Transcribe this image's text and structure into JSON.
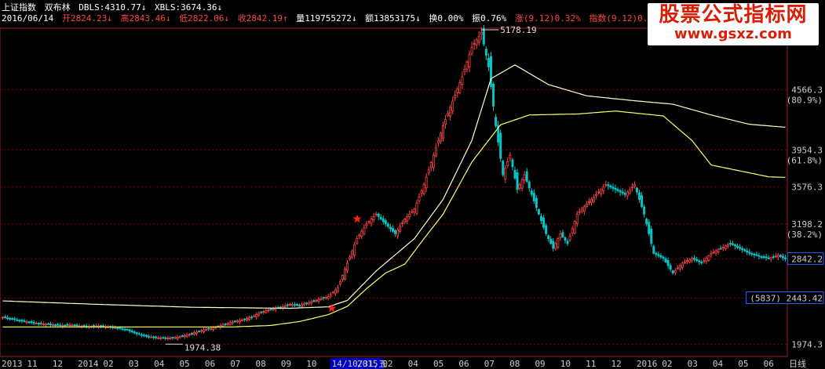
{
  "header": {
    "index_name": "上证指数",
    "indicator_name": "双布林",
    "dbls": "DBLS:4310.77↓",
    "xbls": "XBLS:3674.36↓",
    "date": "2016/06/14",
    "open": "开2824.23↓",
    "high": "高2843.46↓",
    "low": "低2822.06↓",
    "close": "收2842.19↑",
    "volume": "量119755272↓",
    "amount": "额13853175↓",
    "turnover": "换0.00%",
    "amplitude": "振0.76%",
    "change": "涨(9.12)0.32%",
    "index_change": "指数(9.12)0.32%"
  },
  "watermark": {
    "title": "股票公式指标网",
    "url": "www.gsxz.com"
  },
  "colors": {
    "up": "#ff4444",
    "down": "#00c8c8",
    "ma_long": "#ffffcc",
    "ma_mid": "#ffff66",
    "grid": "#8b0000",
    "axis": "#a02020",
    "label": "#cccccc",
    "star": "#ff2020",
    "header_red": "#ff4444",
    "header_cyan": "#00d0d0",
    "date_hl_bg": "#0000c0"
  },
  "chart_data": {
    "type": "candlestick",
    "symbol": "上证指数",
    "ylim": [
      1849,
      5178.19
    ],
    "y_ticks": [
      {
        "value": 4566.3,
        "label": "4566.3",
        "sub": "(80.9%)"
      },
      {
        "value": 3954.3,
        "label": "3954.3",
        "sub": "(61.8%)"
      },
      {
        "value": 3576.3,
        "label": "3576.3",
        "sub": ""
      },
      {
        "value": 3198.2,
        "label": "3198.2",
        "sub": "(38.2%)"
      },
      {
        "value": 2842.2,
        "label": "2842.2",
        "sub": "",
        "boxed": true
      },
      {
        "value": 2443.42,
        "label": "2443.42",
        "sub": "",
        "boxed": true,
        "pre": "(5837)"
      },
      {
        "value": 1974.3,
        "label": "1974.3",
        "sub": ""
      }
    ],
    "x_labels": [
      "2013",
      "11",
      "12",
      "2014",
      "02",
      "03",
      "04",
      "05",
      "06",
      "07",
      "08",
      "09",
      "10",
      "14/10/31,五",
      "2015",
      "02",
      "04",
      "05",
      "06",
      "07",
      "08",
      "09",
      "10",
      "11",
      "12",
      "2016",
      "02",
      "03",
      "04",
      "05",
      "06",
      "日线"
    ],
    "highlighted_x_label": "14/10/31,五",
    "annotations": [
      {
        "text": "5178.19",
        "type": "max",
        "value": 5178.19
      },
      {
        "text": "1974.38",
        "type": "min",
        "value": 1974.38
      }
    ],
    "stars": [
      {
        "near_label": "14/10/31,五",
        "value": 2340
      },
      {
        "near_label": "2015",
        "value": 3250
      }
    ],
    "series": [
      {
        "points": [
          [
            0,
            2250
          ],
          [
            4,
            2230
          ],
          [
            8,
            2210
          ],
          [
            12,
            2195
          ],
          [
            16,
            2180
          ],
          [
            20,
            2175
          ],
          [
            24,
            2165
          ],
          [
            28,
            2170
          ],
          [
            32,
            2160
          ],
          [
            36,
            2155
          ],
          [
            40,
            2160
          ],
          [
            44,
            2150
          ],
          [
            48,
            2140
          ],
          [
            52,
            2120
          ],
          [
            56,
            2080
          ],
          [
            60,
            2055
          ],
          [
            64,
            2040
          ],
          [
            68,
            2035
          ],
          [
            72,
            2040
          ],
          [
            76,
            2060
          ],
          [
            80,
            2090
          ],
          [
            84,
            2120
          ],
          [
            88,
            2140
          ],
          [
            92,
            2170
          ],
          [
            96,
            2200
          ],
          [
            100,
            2220
          ],
          [
            104,
            2250
          ],
          [
            108,
            2300
          ],
          [
            112,
            2330
          ],
          [
            116,
            2350
          ],
          [
            120,
            2380
          ],
          [
            124,
            2370
          ],
          [
            128,
            2400
          ],
          [
            132,
            2430
          ],
          [
            136,
            2460
          ],
          [
            140,
            2550
          ],
          [
            144,
            2800
          ],
          [
            148,
            3050
          ],
          [
            152,
            3200
          ],
          [
            156,
            3300
          ],
          [
            160,
            3200
          ],
          [
            164,
            3100
          ],
          [
            168,
            3250
          ],
          [
            172,
            3350
          ],
          [
            176,
            3600
          ],
          [
            180,
            3900
          ],
          [
            184,
            4200
          ],
          [
            188,
            4450
          ],
          [
            192,
            4700
          ],
          [
            196,
            5000
          ],
          [
            200,
            5150
          ],
          [
            203,
            4800
          ],
          [
            206,
            4200
          ],
          [
            209,
            3700
          ],
          [
            212,
            3900
          ],
          [
            215,
            3550
          ],
          [
            218,
            3700
          ],
          [
            221,
            3500
          ],
          [
            224,
            3300
          ],
          [
            227,
            3100
          ],
          [
            230,
            2950
          ],
          [
            233,
            3100
          ],
          [
            236,
            3000
          ],
          [
            240,
            3300
          ],
          [
            244,
            3400
          ],
          [
            248,
            3500
          ],
          [
            252,
            3600
          ],
          [
            256,
            3550
          ],
          [
            260,
            3500
          ],
          [
            264,
            3600
          ],
          [
            268,
            3300
          ],
          [
            272,
            2900
          ],
          [
            276,
            2850
          ],
          [
            280,
            2700
          ],
          [
            284,
            2800
          ],
          [
            288,
            2850
          ],
          [
            292,
            2800
          ],
          [
            296,
            2900
          ],
          [
            300,
            2950
          ],
          [
            304,
            3000
          ],
          [
            308,
            2950
          ],
          [
            312,
            2900
          ],
          [
            316,
            2870
          ],
          [
            320,
            2850
          ],
          [
            324,
            2880
          ],
          [
            327,
            2842
          ]
        ]
      },
      {
        "points": [
          [
            0,
            2415
          ],
          [
            40,
            2380
          ],
          [
            80,
            2350
          ],
          [
            120,
            2340
          ],
          [
            136,
            2355
          ],
          [
            144,
            2420
          ],
          [
            156,
            2720
          ],
          [
            172,
            3050
          ],
          [
            184,
            3450
          ],
          [
            196,
            4050
          ],
          [
            204,
            4680
          ],
          [
            214,
            4820
          ],
          [
            228,
            4620
          ],
          [
            244,
            4505
          ],
          [
            264,
            4455
          ],
          [
            280,
            4420
          ],
          [
            296,
            4310
          ],
          [
            312,
            4215
          ],
          [
            327,
            4185
          ]
        ]
      },
      {
        "points": [
          [
            0,
            2150
          ],
          [
            40,
            2150
          ],
          [
            80,
            2150
          ],
          [
            96,
            2150
          ],
          [
            112,
            2165
          ],
          [
            124,
            2205
          ],
          [
            136,
            2275
          ],
          [
            144,
            2360
          ],
          [
            152,
            2540
          ],
          [
            160,
            2700
          ],
          [
            168,
            2790
          ],
          [
            176,
            3050
          ],
          [
            184,
            3300
          ],
          [
            196,
            3830
          ],
          [
            208,
            4210
          ],
          [
            220,
            4310
          ],
          [
            240,
            4320
          ],
          [
            256,
            4350
          ],
          [
            276,
            4300
          ],
          [
            288,
            4050
          ],
          [
            296,
            3800
          ],
          [
            308,
            3740
          ],
          [
            320,
            3680
          ],
          [
            327,
            3674
          ]
        ]
      }
    ]
  }
}
